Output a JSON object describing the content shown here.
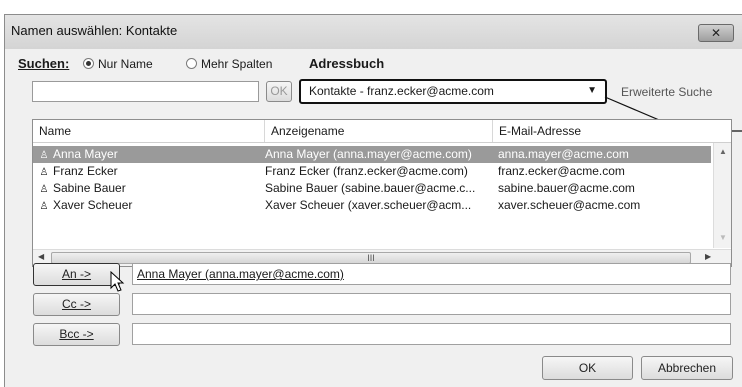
{
  "window": {
    "title": "Namen auswählen: Kontakte",
    "close_glyph": "✕"
  },
  "search": {
    "label": "Suchen:",
    "radio_name_only": "Nur Name",
    "radio_more_columns": "Mehr Spalten",
    "selected_mode": "Nur Name",
    "query_value": "",
    "ok_label": "OK"
  },
  "addressbook": {
    "label": "Adressbuch",
    "selected": "Kontakte - franz.ecker@acme.com",
    "advanced_search": "Erweiterte Suche"
  },
  "list": {
    "columns": [
      "Name",
      "Anzeigename",
      "E-Mail-Adresse"
    ],
    "rows": [
      {
        "name": "Anna Mayer",
        "display": "Anna Mayer (anna.mayer@acme.com)",
        "email": "anna.mayer@acme.com",
        "selected": true
      },
      {
        "name": "Franz Ecker",
        "display": "Franz Ecker (franz.ecker@acme.com)",
        "email": "franz.ecker@acme.com",
        "selected": false
      },
      {
        "name": "Sabine Bauer",
        "display": "Sabine Bauer (sabine.bauer@acme.c...",
        "email": "sabine.bauer@acme.com",
        "selected": false
      },
      {
        "name": "Xaver Scheuer",
        "display": "Xaver Scheuer (xaver.scheuer@acm...",
        "email": "xaver.scheuer@acme.com",
        "selected": false
      }
    ],
    "hscroll_thumb_glyph": "III"
  },
  "recipients": {
    "to_label": "An ->",
    "to_value": "Anna Mayer (anna.mayer@acme.com)",
    "cc_label": "Cc ->",
    "cc_value": "",
    "bcc_label": "Bcc ->",
    "bcc_value": ""
  },
  "buttons": {
    "ok": "OK",
    "cancel": "Abbrechen"
  },
  "icons": {
    "person": "person-icon",
    "close": "close-icon",
    "dropdown": "chevron-down-icon",
    "cursor": "mouse-pointer-icon"
  }
}
